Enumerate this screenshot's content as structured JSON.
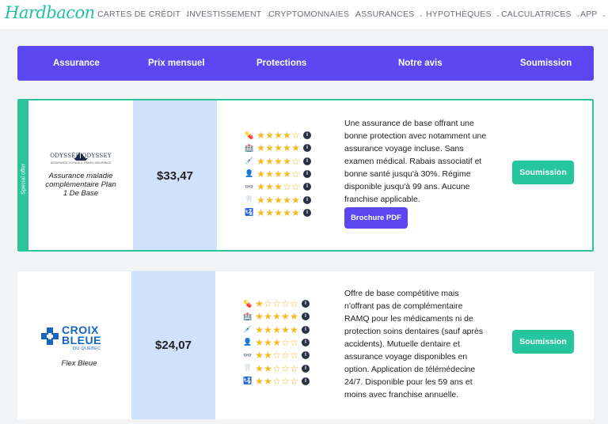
{
  "brand": {
    "logo": "Hardbacon",
    "color": "#22c1a3"
  },
  "nav": {
    "items": [
      {
        "label": "CARTES DE CRÉDIT"
      },
      {
        "label": "INVESTISSEMENT"
      },
      {
        "label": "CRYPTOMONNAIES"
      },
      {
        "label": "ASSURANCES"
      },
      {
        "label": "HYPOTHÈQUES"
      },
      {
        "label": "CALCULATRICES"
      },
      {
        "label": "APP"
      }
    ],
    "chevron": "⌄"
  },
  "table": {
    "accent": "#5b48f2",
    "columns": [
      "Assurance",
      "Prix mensuel",
      "Protections",
      "Notre avis",
      "Soumission"
    ]
  },
  "protection_icons": [
    "pill-icon",
    "hospital-icon",
    "syringe-icon",
    "doctor-icon",
    "glasses-icon",
    "tooth-icon",
    "passport-icon"
  ],
  "protection_glyphs": [
    "💊",
    "🏥",
    "💉",
    "👤",
    "👓",
    "🦷",
    "🛂"
  ],
  "offers": [
    {
      "badge": "Special offer",
      "logo_text": "ODYSSÉE ODYSSEY",
      "logo_subtext": "ASSURANCE VOYAGE & TRAVEL INSURANCE",
      "product": "Assurance maladie complémentaire Plan 1 De Base",
      "price": "$33,47",
      "ratings": [
        4,
        5,
        4,
        4,
        3,
        5,
        5
      ],
      "review_lines": [
        "Une assurance de base offrant une",
        "bonne protection avec notamment une",
        "assurance voyage incluse. Sans",
        "examen médical. Rabais associatif et",
        "bonne santé jusqu'à 30%. Régime",
        "disponible jusqu'à 99 ans. Aucune",
        "franchise applicable."
      ],
      "brochure": "Brochure PDF",
      "cta": "Soumission"
    },
    {
      "logo_text": [
        "CROIX",
        "BLEUE"
      ],
      "logo_subtext": "DU QUÉBEC",
      "product": "Flex Bleue",
      "price": "$24,07",
      "ratings": [
        1,
        5,
        5,
        3,
        2,
        2,
        2
      ],
      "review_lines": [
        "Offre de base compétitive mais",
        "n'offrant pas de complémentaire",
        "RAMQ pour les médicaments ni de",
        "protection soins dentaires (sauf après",
        "accidents). Mutuelle dentaire et",
        "assurance voyage disponibles en",
        "option. Application de télémédecine",
        "24/7. Disponible pour les 59 ans et",
        "moins avec franchise annuelle."
      ],
      "cta": "Soumission"
    }
  ]
}
